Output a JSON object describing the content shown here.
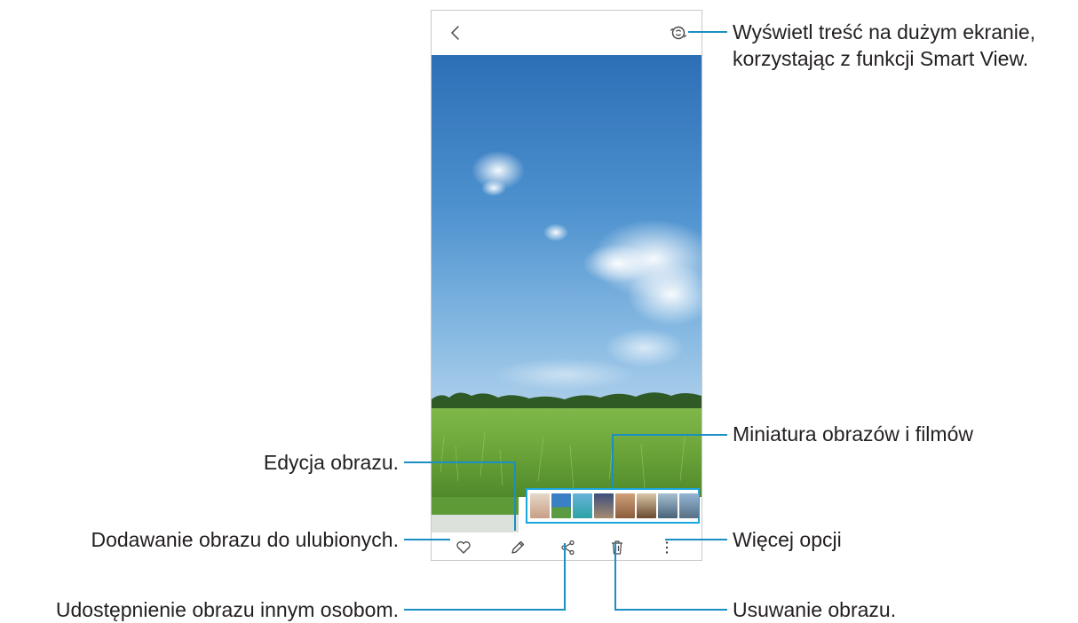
{
  "callouts": {
    "smart_view_line1": "Wyświetl treść na dużym ekranie,",
    "smart_view_line2": "korzystając z funkcji Smart View.",
    "thumbnails": "Miniatura obrazów i filmów",
    "more_options": "Więcej opcji",
    "delete": "Usuwanie obrazu.",
    "edit": "Edycja obrazu.",
    "favorite": "Dodawanie obrazu do ulubionych.",
    "share": "Udostępnienie obrazu innym osobom."
  },
  "icons": {
    "back": "chevron-left-icon",
    "smart_view": "smart-view-icon",
    "favorite": "heart-icon",
    "edit": "pencil-icon",
    "share": "share-icon",
    "delete": "trash-icon",
    "more": "more-vertical-icon"
  },
  "colors": {
    "callout_line": "#1b8fc2",
    "thumbnail_highlight": "#1ba6dd"
  }
}
